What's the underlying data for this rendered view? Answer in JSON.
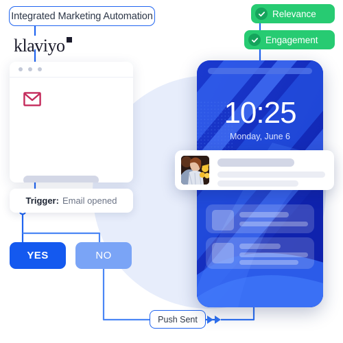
{
  "title_label": "Integrated Marketing Automation",
  "brand": {
    "name": "klaviyo",
    "trademark": "tm-square"
  },
  "email_card": {
    "window_dots": 3,
    "icon": "envelope-icon",
    "accent_color": "#c42a5b"
  },
  "trigger": {
    "key": "Trigger:",
    "value": "Email opened"
  },
  "decision": {
    "yes_label": "YES",
    "no_label": "NO",
    "yes_color": "#1459ef",
    "no_color": "#7aa4f6"
  },
  "push": {
    "label": "Push Sent",
    "arrows": 2
  },
  "badges": [
    {
      "label": "Relevance",
      "icon": "check-circle-icon",
      "color": "#27cb72"
    },
    {
      "label": "Engagement",
      "icon": "check-circle-icon",
      "color": "#27cb72"
    }
  ],
  "phone": {
    "time": "10:25",
    "date": "Monday, June 6",
    "wallpaper_color": "#1329b9",
    "status_bar": "status-bar"
  },
  "notification": {
    "thumbnail": "portrait-photo",
    "lines": 3
  },
  "colors": {
    "accent_blue": "#1f64f0",
    "background_circle": "#e7edfb",
    "green": "#27cb72",
    "crimson": "#c42a5b"
  }
}
